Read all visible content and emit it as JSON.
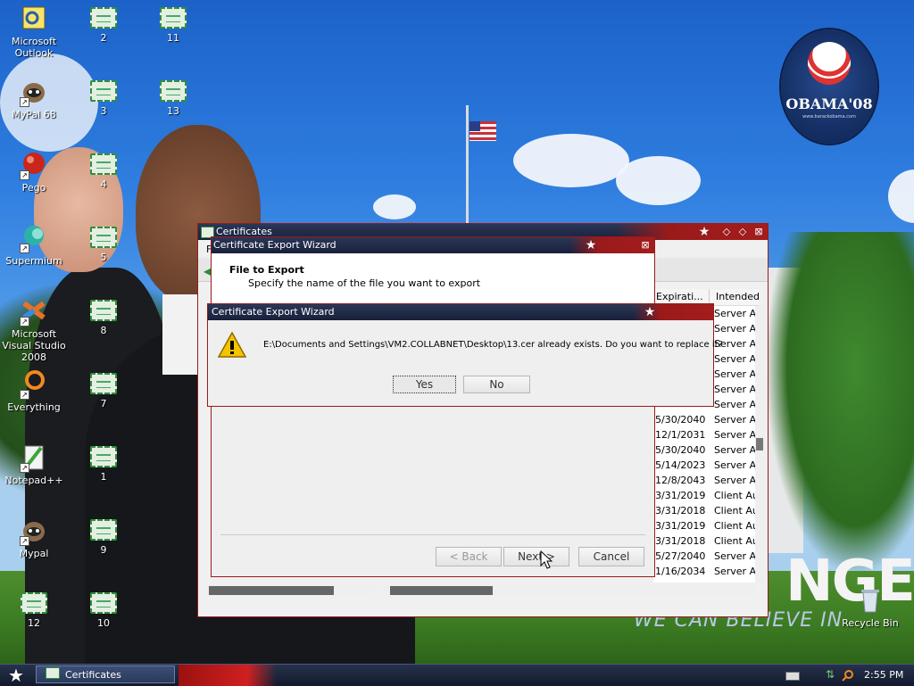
{
  "desktop": {
    "icons": [
      {
        "label": "Microsoft Outlook",
        "icon": "outlook-icon"
      },
      {
        "label": "MyPal 68",
        "icon": "mypal-icon"
      },
      {
        "label": "Pego",
        "icon": "pego-icon"
      },
      {
        "label": "Supermium",
        "icon": "supermium-icon"
      },
      {
        "label": "Microsoft Visual Studio 2008",
        "icon": "visual-studio-icon"
      },
      {
        "label": "Everything",
        "icon": "everything-icon"
      },
      {
        "label": "Notepad++",
        "icon": "notepadpp-icon"
      },
      {
        "label": "Mypal",
        "icon": "mypal-icon"
      },
      {
        "label": "12",
        "icon": "certificate-file-icon"
      },
      {
        "label": "2",
        "icon": "certificate-file-icon"
      },
      {
        "label": "3",
        "icon": "certificate-file-icon"
      },
      {
        "label": "4",
        "icon": "certificate-file-icon"
      },
      {
        "label": "5",
        "icon": "certificate-file-icon"
      },
      {
        "label": "8",
        "icon": "certificate-file-icon"
      },
      {
        "label": "7",
        "icon": "certificate-file-icon"
      },
      {
        "label": "1",
        "icon": "certificate-file-icon"
      },
      {
        "label": "9",
        "icon": "certificate-file-icon"
      },
      {
        "label": "10",
        "icon": "certificate-file-icon"
      },
      {
        "label": "11",
        "icon": "certificate-file-icon"
      },
      {
        "label": "13",
        "icon": "certificate-file-icon"
      },
      {
        "label": "Recycle Bin",
        "icon": "recycle-bin-icon"
      }
    ],
    "wallpaper": {
      "logo_text": "OBAMA'08",
      "logo_sub": "www.barackobama.com",
      "billboard": "NGE",
      "billboard_sub": "WE CAN BELIEVE IN"
    }
  },
  "certificates_window": {
    "title": "Certificates",
    "menu_fragment": "F",
    "columns": [
      "Expirati...",
      "Intended"
    ],
    "rows": [
      {
        "expiration": "",
        "intended": "Server Au"
      },
      {
        "expiration": "",
        "intended": "Server Au"
      },
      {
        "expiration": "",
        "intended": "Server Au"
      },
      {
        "expiration": "",
        "intended": "Server Au"
      },
      {
        "expiration": "",
        "intended": "Server Au"
      },
      {
        "expiration": "",
        "intended": "Server Au"
      },
      {
        "expiration": "",
        "intended": "Server Au"
      },
      {
        "expiration": "5/30/2040",
        "intended": "Server Au"
      },
      {
        "expiration": "12/1/2031",
        "intended": "Server Au"
      },
      {
        "expiration": "5/30/2040",
        "intended": "Server Au"
      },
      {
        "expiration": "5/14/2023",
        "intended": "Server Au"
      },
      {
        "expiration": "12/8/2043",
        "intended": "Server Au"
      },
      {
        "expiration": "3/31/2019",
        "intended": "Client Aut"
      },
      {
        "expiration": "3/31/2018",
        "intended": "Client Aut"
      },
      {
        "expiration": "3/31/2019",
        "intended": "Client Aut"
      },
      {
        "expiration": "3/31/2018",
        "intended": "Client Aut"
      },
      {
        "expiration": "5/27/2040",
        "intended": "Server Au"
      },
      {
        "expiration": "1/16/2034",
        "intended": "Server Au"
      }
    ]
  },
  "export_wizard": {
    "title": "Certificate Export Wizard",
    "heading": "File to Export",
    "subheading": "Specify the name of the file you want to export",
    "back_label": "< Back",
    "next_label": "Next >",
    "cancel_label": "Cancel"
  },
  "confirm_dialog": {
    "title": "Certificate Export Wizard",
    "message": "E:\\Documents and Settings\\VM2.COLLABNET\\Desktop\\13.cer already exists. Do you want to replace it?",
    "yes_label": "Yes",
    "no_label": "No"
  },
  "taskbar": {
    "task_label": "Certificates",
    "clock": "2:55 PM"
  },
  "colors": {
    "titlebar": "#18203a",
    "accent_red": "#9a1a1a",
    "warning": "#f5c400"
  }
}
